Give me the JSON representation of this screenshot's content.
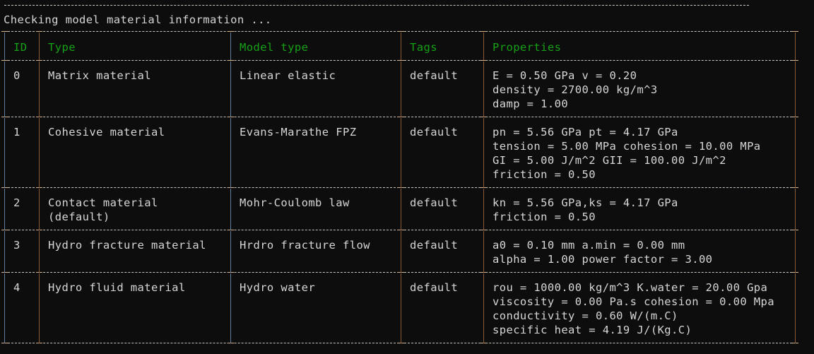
{
  "terminal": {
    "status_message": "Checking model material information ...",
    "background_color": "#0d0d0d",
    "text_color": "#d6d6d6",
    "header_color": "#15a015",
    "rule_color": "#c9c6bd"
  },
  "table": {
    "name": "model-material-table",
    "columns": [
      {
        "key": "id",
        "label": "ID"
      },
      {
        "key": "type",
        "label": "Type"
      },
      {
        "key": "model_type",
        "label": "Model type"
      },
      {
        "key": "tags",
        "label": "Tags"
      },
      {
        "key": "properties",
        "label": "Properties"
      }
    ],
    "rows": [
      {
        "id": "0",
        "type": "Matrix material",
        "model_type": "Linear elastic",
        "tags": "default",
        "properties": [
          "E = 0.50 GPa v = 0.20",
          "density = 2700.00 kg/m^3",
          "damp = 1.00"
        ]
      },
      {
        "id": "1",
        "type": "Cohesive material",
        "model_type": "Evans-Marathe FPZ",
        "tags": "default",
        "properties": [
          "pn = 5.56 GPa pt = 4.17 GPa",
          "tension = 5.00 MPa cohesion = 10.00 MPa",
          "GI = 5.00 J/m^2 GII = 100.00 J/m^2",
          "friction = 0.50"
        ]
      },
      {
        "id": "2",
        "type": "Contact material\n(default)",
        "model_type": "Mohr-Coulomb law",
        "tags": "default",
        "properties": [
          "kn = 5.56 GPa,ks = 4.17 GPa",
          "friction = 0.50"
        ]
      },
      {
        "id": "3",
        "type": "Hydro fracture material",
        "model_type": "Hrdro fracture flow",
        "tags": "default",
        "properties": [
          "a0 = 0.10 mm a.min = 0.00 mm",
          "alpha = 1.00 power factor = 3.00"
        ]
      },
      {
        "id": "4",
        "type": "Hydro fluid material",
        "model_type": "Hydro water",
        "tags": "default",
        "properties": [
          "rou = 1000.00 kg/m^3 K.water = 20.00 Gpa",
          "viscosity = 0.00 Pa.s cohesion = 0.00 Mpa",
          "conductivity = 0.60 W/(m.C)",
          "specific heat = 4.19 J/(Kg.C)"
        ]
      }
    ]
  }
}
